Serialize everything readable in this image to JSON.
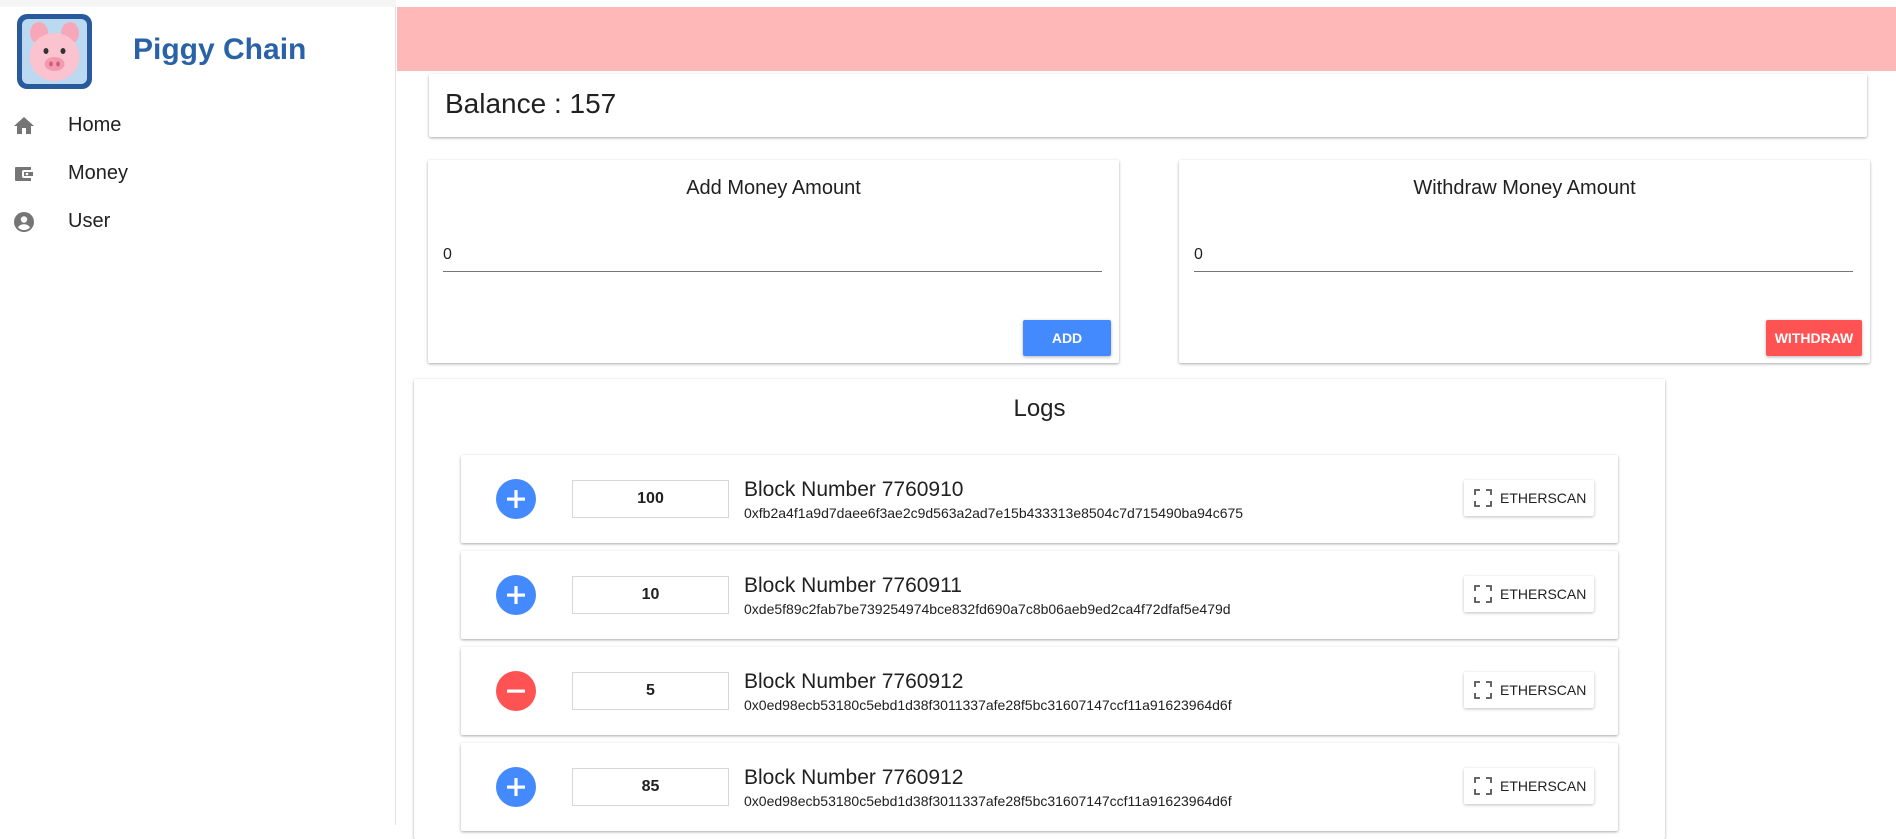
{
  "app": {
    "title": "Piggy Chain"
  },
  "sidebar": {
    "items": [
      {
        "label": "Home",
        "icon": "home-icon"
      },
      {
        "label": "Money",
        "icon": "wallet-icon"
      },
      {
        "label": "User",
        "icon": "account-circle-icon"
      }
    ]
  },
  "banner": {
    "color": "#ffb8b8"
  },
  "balance": {
    "label": "Balance : ",
    "value": "157"
  },
  "add_money": {
    "title": "Add Money Amount",
    "value": "0",
    "button_label": "ADD",
    "button_color": "#448aff"
  },
  "withdraw_money": {
    "title": "Withdraw Money Amount",
    "value": "0",
    "button_label": "WITHDRAW",
    "button_color": "#ff5252"
  },
  "logs": {
    "title": "Logs",
    "button_label": "ETHERSCAN",
    "rows": [
      {
        "type": "deposit",
        "icon": "plus-circle-icon",
        "amount": "100",
        "block": "Block Number 7760910",
        "hash": "0xfb2a4f1a9d7daee6f3ae2c9d563a2ad7e15b433313e8504c7d715490ba94c675"
      },
      {
        "type": "deposit",
        "icon": "plus-circle-icon",
        "amount": "10",
        "block": "Block Number 7760911",
        "hash": "0xde5f89c2fab7be739254974bce832fd690a7c8b06aeb9ed2ca4f72dfaf5e479d"
      },
      {
        "type": "withdraw",
        "icon": "minus-circle-icon",
        "amount": "5",
        "block": "Block Number 7760912",
        "hash": "0x0ed98ecb53180c5ebd1d38f3011337afe28f5bc31607147ccf11a91623964d6f"
      },
      {
        "type": "deposit",
        "icon": "plus-circle-icon",
        "amount": "85",
        "block": "Block Number 7760912",
        "hash": "0x0ed98ecb53180c5ebd1d38f3011337afe28f5bc31607147ccf11a91623964d6f"
      }
    ]
  },
  "colors": {
    "accent": "#448aff",
    "danger": "#ff5252",
    "title": "#2a62a8"
  }
}
